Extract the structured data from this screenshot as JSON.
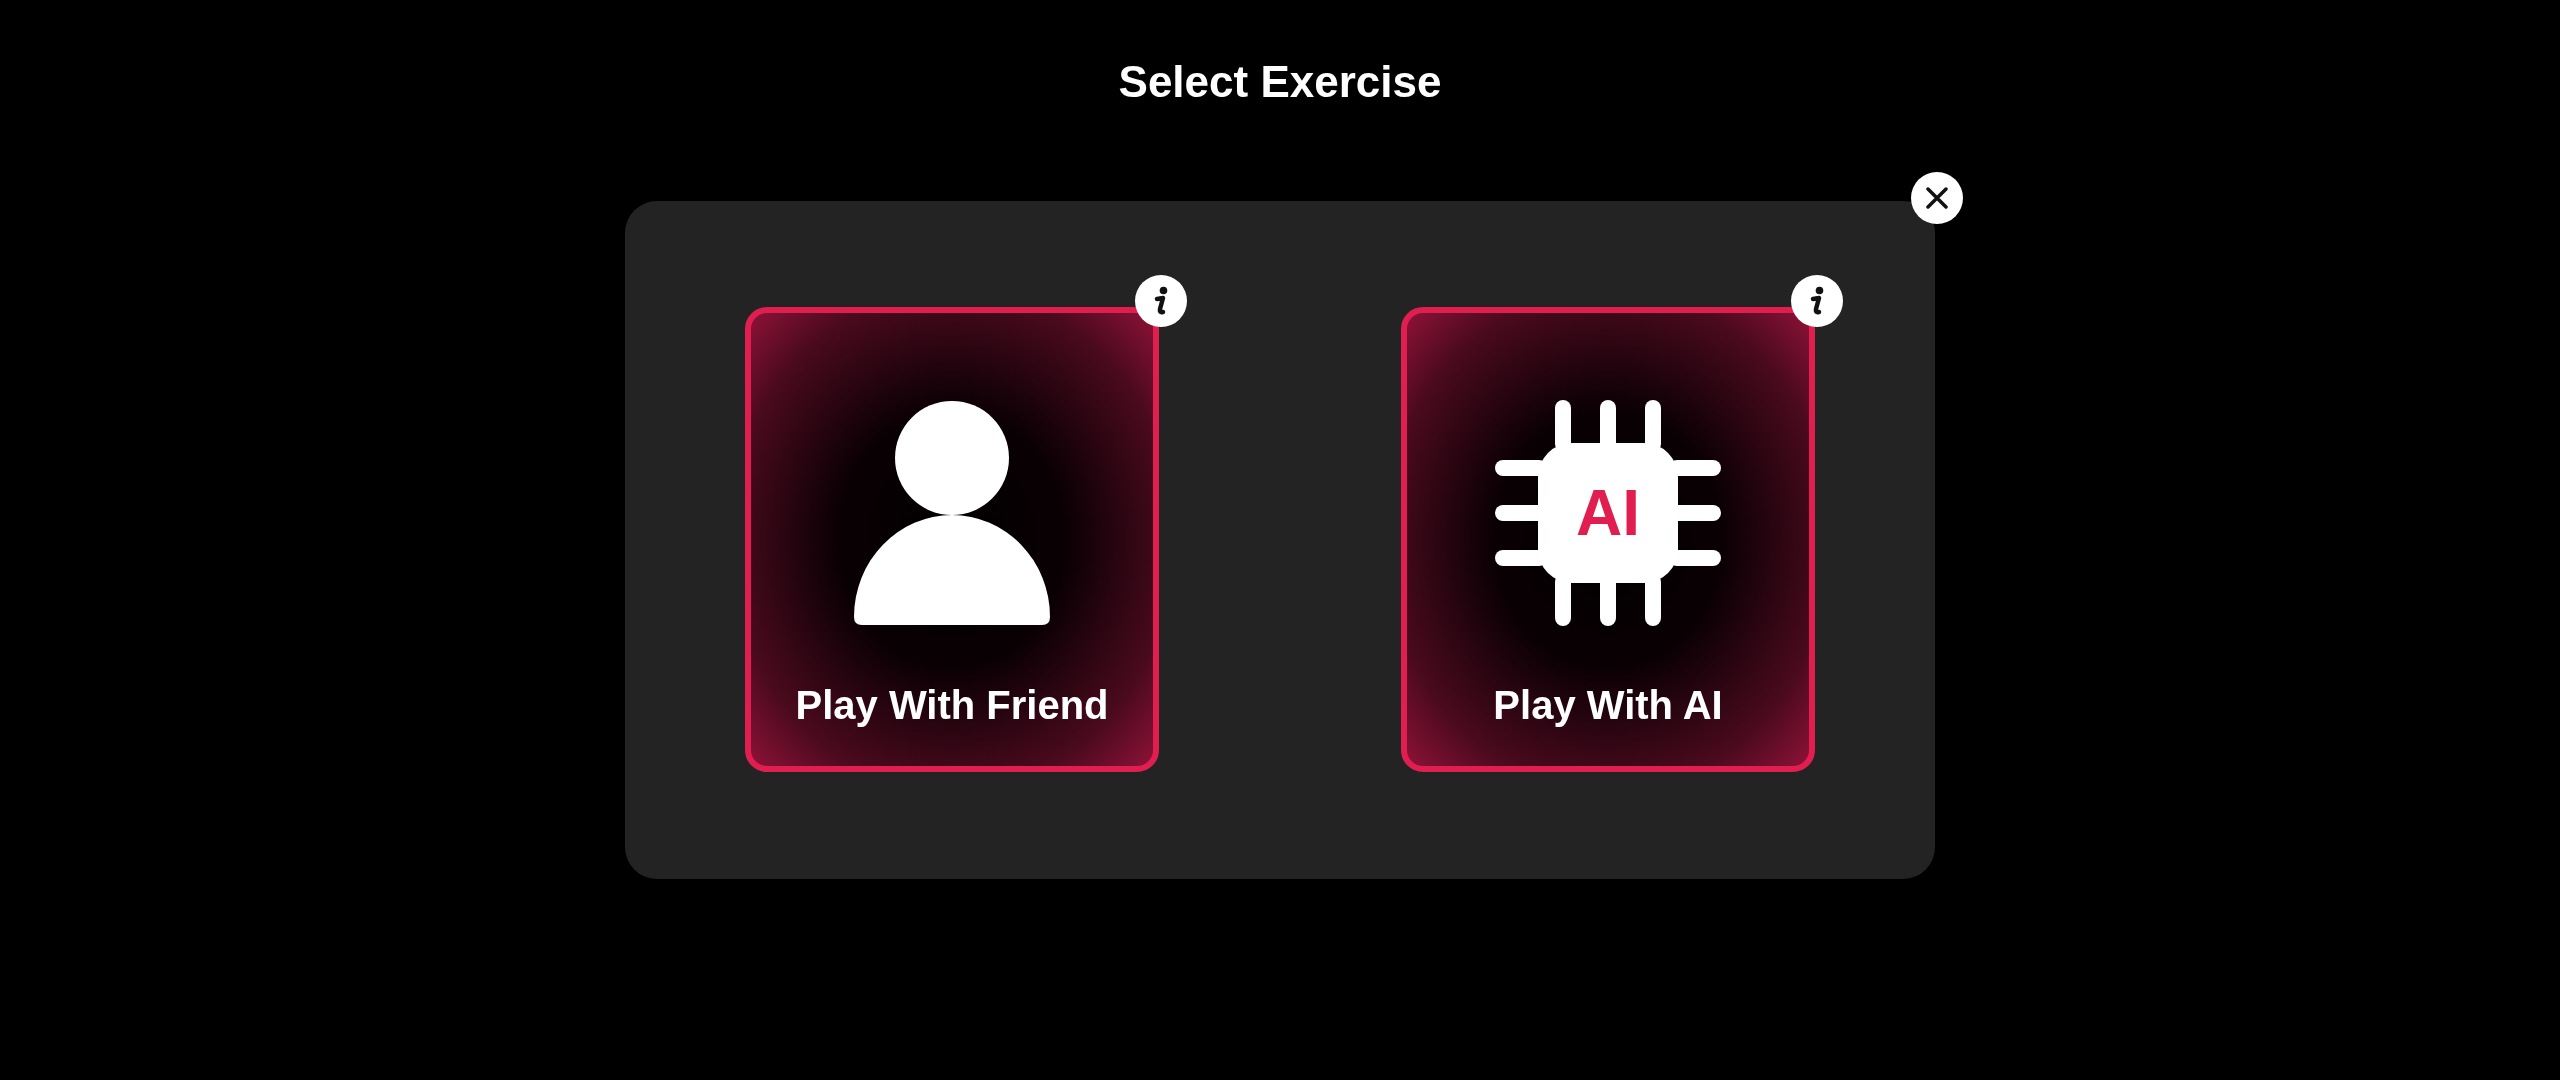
{
  "title": "Select Exercise",
  "options": [
    {
      "kind": "friend",
      "label": "Play With Friend"
    },
    {
      "kind": "ai",
      "label": "Play With AI",
      "chip_text": "AI"
    }
  ]
}
